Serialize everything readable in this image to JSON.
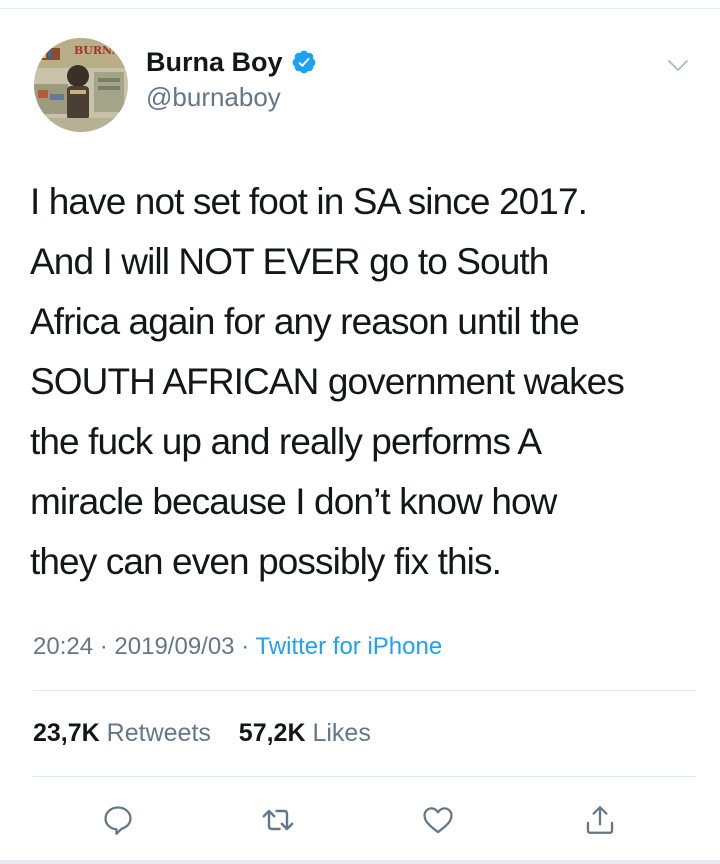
{
  "author": {
    "display_name": "Burna Boy",
    "handle": "@burnaboy",
    "verified": true,
    "avatar_label": "BURNA BOY"
  },
  "tweet": {
    "lines": [
      "I have not set foot in SA since 2017.",
      "And I will NOT EVER go to South",
      "Africa again for any reason until the",
      "SOUTH AFRICAN government wakes",
      "the fuck up and really performs A",
      "miracle because I don’t know how",
      "they can even possibly fix this."
    ]
  },
  "meta": {
    "time": "20:24",
    "separator": "·",
    "date": "2019/09/03",
    "source": "Twitter for iPhone"
  },
  "stats": {
    "retweets_count": "23,7K",
    "retweets_label": "Retweets",
    "likes_count": "57,2K",
    "likes_label": "Likes"
  },
  "actions": [
    {
      "name": "reply-icon"
    },
    {
      "name": "retweet-icon"
    },
    {
      "name": "like-icon"
    },
    {
      "name": "share-icon"
    }
  ],
  "colors": {
    "text": "#14171a",
    "secondary": "#657786",
    "accent": "#1da1f2",
    "divider": "#e1e8ed"
  }
}
